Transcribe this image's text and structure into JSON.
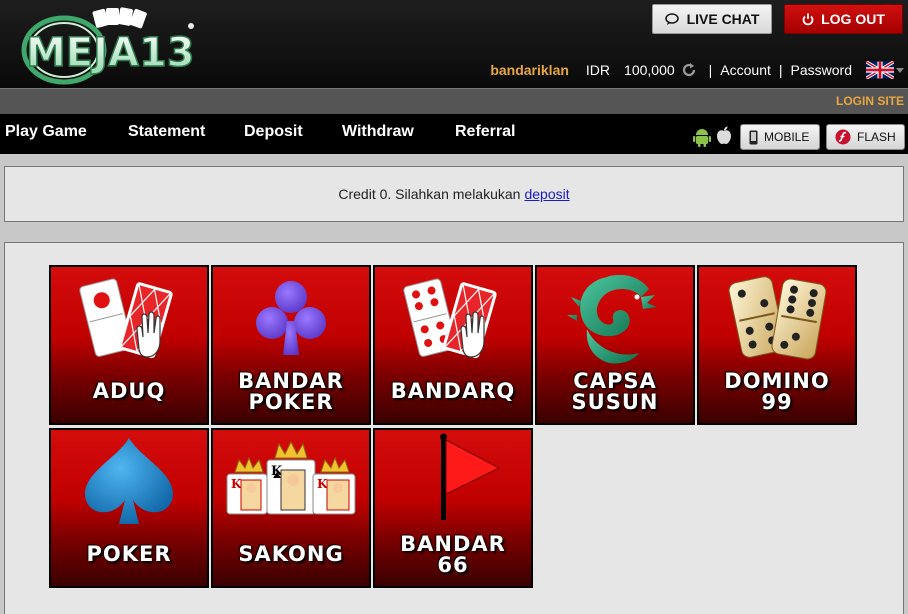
{
  "header": {
    "logo_text": "MEJA13",
    "live_chat_label": "LIVE CHAT",
    "logout_label": "LOG OUT",
    "username": "bandariklan",
    "currency": "IDR",
    "balance": "100,000",
    "account_label": "Account",
    "password_label": "Password",
    "language_icon": "uk-flag-icon"
  },
  "login_bar": {
    "label": "LOGIN SITE"
  },
  "nav": {
    "items": [
      "Play Game",
      "Statement",
      "Deposit",
      "Withdraw",
      "Referral"
    ],
    "mobile_label": "MOBILE",
    "flash_label": "FLASH"
  },
  "credit": {
    "message": "Credit 0. Silahkan melakukan",
    "link": "deposit"
  },
  "games": [
    {
      "label": "ADUQ",
      "icon": "domino-card-hand-icon"
    },
    {
      "label": "BANDAR\nPOKER",
      "icon": "club-icon"
    },
    {
      "label": "BANDARQ",
      "icon": "domino-card-hand-icon"
    },
    {
      "label": "CAPSA\nSUSUN",
      "icon": "dragon-icon"
    },
    {
      "label": "DOMINO\n99",
      "icon": "dice-domino-icon"
    },
    {
      "label": "POKER",
      "icon": "spade-icon"
    },
    {
      "label": "SAKONG",
      "icon": "king-cards-icon"
    },
    {
      "label": "BANDAR\n66",
      "icon": "red-flag-icon"
    }
  ],
  "colors": {
    "brand_red": "#c00000",
    "username_gold": "#e8a640",
    "nav_bg": "#000000"
  }
}
